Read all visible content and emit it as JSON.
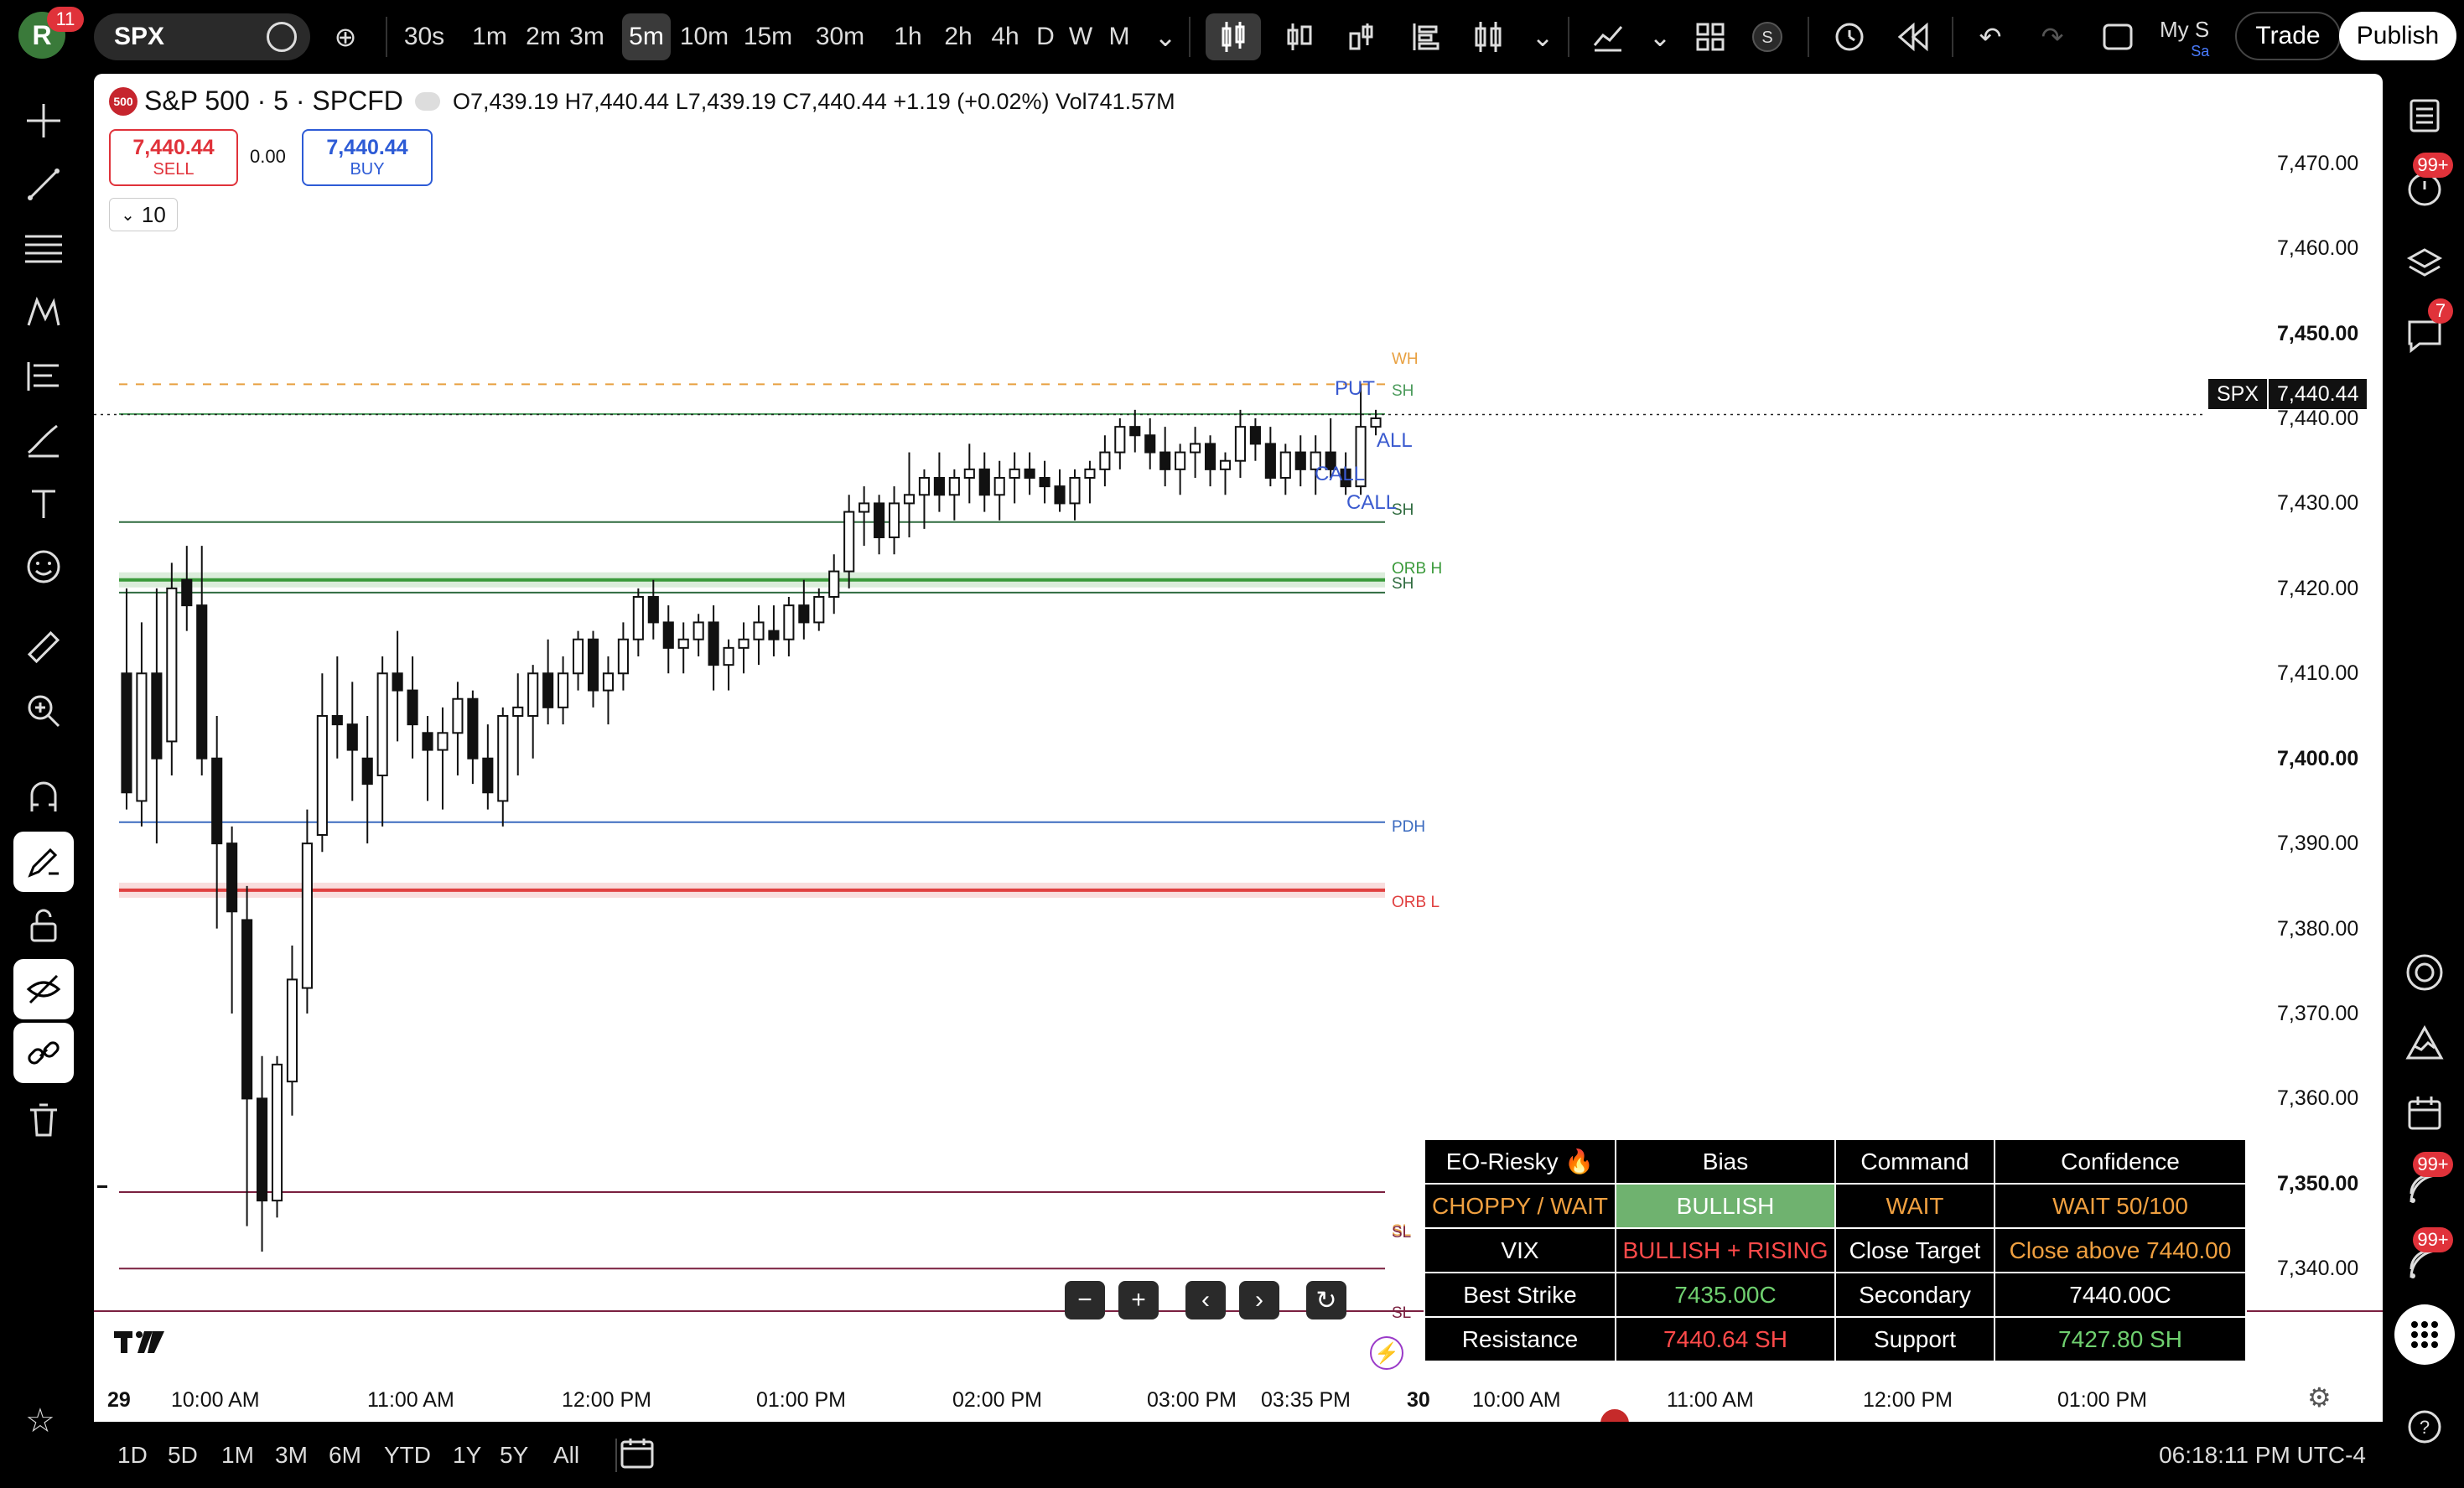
{
  "topbar": {
    "avatar_letter": "R",
    "notification_count": "11",
    "symbol": "SPX",
    "intervals": [
      "30s",
      "1m",
      "2m",
      "3m",
      "5m",
      "10m",
      "15m",
      "30m",
      "1h",
      "2h",
      "4h",
      "D",
      "W",
      "M"
    ],
    "active_interval": "5m",
    "my_s": "My S",
    "my_s_sub": "Sa",
    "trade_label": "Trade",
    "publish_label": "Publish"
  },
  "legend": {
    "logo": "500",
    "title": "S&P 500 · 5 · SPCFD",
    "ohlc": "O7,439.19  H7,440.44  L7,439.19  C7,440.44  +1.19 (+0.02%)  Vol741.57M",
    "sell_price": "7,440.44",
    "sell_label": "SELL",
    "spread": "0.00",
    "buy_price": "7,440.44",
    "buy_label": "BUY",
    "qty": "10"
  },
  "price_tag": {
    "symbol": "SPX",
    "value": "7,440.44"
  },
  "chart_data": {
    "type": "candlestick",
    "y_ticks": [
      "7,470.00",
      "7,460.00",
      "7,450.00",
      "7,440.00",
      "7,430.00",
      "7,420.00",
      "7,410.00",
      "7,400.00",
      "7,390.00",
      "7,380.00",
      "7,370.00",
      "7,360.00",
      "7,350.00",
      "7,340.00"
    ],
    "ylim": [
      7335,
      7475
    ],
    "x_ticks": [
      "29",
      "10:00 AM",
      "11:00 AM",
      "12:00 PM",
      "01:00 PM",
      "02:00 PM",
      "03:00 PM",
      "03:35 PM",
      "30",
      "10:00 AM",
      "11:00 AM",
      "12:00 PM",
      "01:00 PM"
    ],
    "levels": [
      {
        "label": "WH",
        "price": 7444.0,
        "color": "#e8a040",
        "style": "dashed"
      },
      {
        "label": "SH",
        "price": 7440.5,
        "color": "#4a9a5a",
        "style": "solid"
      },
      {
        "label": "SH",
        "price": 7427.8,
        "color": "#2f6b3f",
        "style": "solid"
      },
      {
        "label": "ORB H",
        "price": 7421.0,
        "color": "#3a9a3a",
        "style": "band"
      },
      {
        "label": "SH",
        "price": 7419.5,
        "color": "#2f6b3f",
        "style": "solid"
      },
      {
        "label": "PDH",
        "price": 7392.5,
        "color": "#3a6abf",
        "style": "solid"
      },
      {
        "label": "ORB L",
        "price": 7384.5,
        "color": "#e04040",
        "style": "band"
      },
      {
        "label": "SL",
        "price": 7349.0,
        "color": "#e8a040",
        "style": "dashed"
      },
      {
        "label": "SL",
        "price": 7349.0,
        "color": "#7a2040",
        "style": "solid"
      },
      {
        "label": "SL",
        "price": 7340.0,
        "color": "#7a2040",
        "style": "solid"
      }
    ],
    "annotations": [
      "PUT",
      "CALL",
      "ALL",
      "CALL"
    ],
    "candles": [
      [
        7410,
        7420,
        7394,
        7396
      ],
      [
        7395,
        7416,
        7392,
        7410
      ],
      [
        7410,
        7420,
        7390,
        7400
      ],
      [
        7402,
        7423,
        7398,
        7420
      ],
      [
        7421,
        7425,
        7415,
        7418
      ],
      [
        7418,
        7425,
        7398,
        7400
      ],
      [
        7400,
        7405,
        7380,
        7390
      ],
      [
        7390,
        7392,
        7370,
        7382
      ],
      [
        7381,
        7385,
        7345,
        7360
      ],
      [
        7360,
        7365,
        7342,
        7348
      ],
      [
        7348,
        7365,
        7346,
        7364
      ],
      [
        7362,
        7378,
        7358,
        7374
      ],
      [
        7373,
        7394,
        7370,
        7390
      ],
      [
        7391,
        7410,
        7389,
        7405
      ],
      [
        7405,
        7412,
        7400,
        7404
      ],
      [
        7404,
        7409,
        7395,
        7401
      ],
      [
        7400,
        7405,
        7390,
        7397
      ],
      [
        7398,
        7412,
        7392,
        7410
      ],
      [
        7410,
        7415,
        7402,
        7408
      ],
      [
        7408,
        7412,
        7400,
        7404
      ],
      [
        7403,
        7405,
        7395,
        7401
      ],
      [
        7401,
        7406,
        7394,
        7403
      ],
      [
        7403,
        7409,
        7398,
        7407
      ],
      [
        7407,
        7408,
        7397,
        7400
      ],
      [
        7400,
        7404,
        7394,
        7396
      ],
      [
        7395,
        7406,
        7392,
        7405
      ],
      [
        7405,
        7410,
        7398,
        7406
      ],
      [
        7405,
        7411,
        7400,
        7410
      ],
      [
        7410,
        7414,
        7404,
        7406
      ],
      [
        7406,
        7412,
        7404,
        7410
      ],
      [
        7410,
        7415,
        7408,
        7414
      ],
      [
        7414,
        7415,
        7406,
        7408
      ],
      [
        7408,
        7412,
        7404,
        7410
      ],
      [
        7410,
        7416,
        7408,
        7414
      ],
      [
        7414,
        7420,
        7412,
        7419
      ],
      [
        7419,
        7421,
        7414,
        7416
      ],
      [
        7416,
        7418,
        7410,
        7413
      ],
      [
        7413,
        7416,
        7410,
        7414
      ],
      [
        7414,
        7417,
        7412,
        7416
      ],
      [
        7416,
        7418,
        7408,
        7411
      ],
      [
        7411,
        7414,
        7408,
        7413
      ],
      [
        7413,
        7416,
        7410,
        7414
      ],
      [
        7414,
        7418,
        7411,
        7416
      ],
      [
        7415,
        7418,
        7412,
        7414
      ],
      [
        7414,
        7419,
        7412,
        7418
      ],
      [
        7418,
        7421,
        7414,
        7416
      ],
      [
        7416,
        7420,
        7415,
        7419
      ],
      [
        7419,
        7424,
        7417,
        7422
      ],
      [
        7422,
        7431,
        7420,
        7429
      ],
      [
        7429,
        7432,
        7425,
        7430
      ],
      [
        7430,
        7431,
        7424,
        7426
      ],
      [
        7426,
        7432,
        7424,
        7430
      ],
      [
        7430,
        7436,
        7426,
        7431
      ],
      [
        7431,
        7434,
        7427,
        7433
      ],
      [
        7433,
        7436,
        7429,
        7431
      ],
      [
        7431,
        7434,
        7428,
        7433
      ],
      [
        7433,
        7437,
        7430,
        7434
      ],
      [
        7434,
        7436,
        7429,
        7431
      ],
      [
        7431,
        7435,
        7428,
        7433
      ],
      [
        7433,
        7436,
        7430,
        7434
      ],
      [
        7434,
        7436,
        7431,
        7433
      ],
      [
        7433,
        7435,
        7430,
        7432
      ],
      [
        7432,
        7434,
        7429,
        7430
      ],
      [
        7430,
        7434,
        7428,
        7433
      ],
      [
        7433,
        7435,
        7430,
        7434
      ],
      [
        7434,
        7438,
        7432,
        7436
      ],
      [
        7436,
        7440,
        7434,
        7439
      ],
      [
        7439,
        7441,
        7436,
        7438
      ],
      [
        7438,
        7440,
        7434,
        7436
      ],
      [
        7436,
        7439,
        7432,
        7434
      ],
      [
        7434,
        7437,
        7431,
        7436
      ],
      [
        7436,
        7439,
        7433,
        7437
      ],
      [
        7437,
        7438,
        7432,
        7434
      ],
      [
        7434,
        7436,
        7431,
        7435
      ],
      [
        7435,
        7441,
        7433,
        7439
      ],
      [
        7439,
        7440,
        7435,
        7437
      ],
      [
        7437,
        7439,
        7432,
        7433
      ],
      [
        7433,
        7437,
        7431,
        7436
      ],
      [
        7436,
        7438,
        7432,
        7434
      ],
      [
        7434,
        7438,
        7431,
        7436
      ],
      [
        7436,
        7440,
        7433,
        7434
      ],
      [
        7434,
        7436,
        7431,
        7432
      ],
      [
        7432,
        7444,
        7431,
        7439
      ],
      [
        7439,
        7441,
        7438,
        7440
      ]
    ]
  },
  "level_labels": {
    "wh": "WH",
    "sh1": "SH",
    "sh2": "SH",
    "orbh": "ORB H",
    "sh3": "SH",
    "pdh": "PDH",
    "orbl": "ORB L",
    "sl1": "SL",
    "sl2": "SL",
    "sl3": "SL",
    "put": "PUT",
    "call1": "CALL",
    "all": "ALL",
    "call2": "CALL",
    "sh_top": "SH"
  },
  "dashboard": {
    "rows": [
      [
        {
          "t": "EO-Riesky 🔥",
          "c": "#ffffff"
        },
        {
          "t": "Bias",
          "c": "#ffffff"
        },
        {
          "t": "Command",
          "c": "#ffffff"
        },
        {
          "t": "Confidence",
          "c": "#ffffff"
        }
      ],
      [
        {
          "t": "CHOPPY / WAIT",
          "c": "#f0a040"
        },
        {
          "t": "BULLISH",
          "c": "#ffffff",
          "bg": "#6fb26f"
        },
        {
          "t": "WAIT",
          "c": "#f0a040"
        },
        {
          "t": "WAIT 50/100",
          "c": "#f0a040"
        }
      ],
      [
        {
          "t": "VIX",
          "c": "#ffffff"
        },
        {
          "t": "BULLISH + RISING",
          "c": "#ff4a4a"
        },
        {
          "t": "Close Target",
          "c": "#ffffff"
        },
        {
          "t": "Close above 7440.00",
          "c": "#f0a040"
        }
      ],
      [
        {
          "t": "Best Strike",
          "c": "#ffffff"
        },
        {
          "t": "7435.00C",
          "c": "#6fd06f"
        },
        {
          "t": "Secondary",
          "c": "#ffffff"
        },
        {
          "t": "7440.00C",
          "c": "#ffffff"
        }
      ],
      [
        {
          "t": "Resistance",
          "c": "#ffffff"
        },
        {
          "t": "7440.64  SH",
          "c": "#ff4a4a"
        },
        {
          "t": "Support",
          "c": "#ffffff"
        },
        {
          "t": "7427.80  SH",
          "c": "#6fd06f"
        }
      ]
    ]
  },
  "bottombar": {
    "ranges": [
      "1D",
      "5D",
      "1M",
      "3M",
      "6M",
      "YTD",
      "1Y",
      "5Y",
      "All"
    ],
    "clock": "06:18:11 PM UTC-4"
  },
  "rightbar": {
    "badge1": "99+",
    "badge2": "7",
    "badge3": "99+",
    "badge4": "99+"
  }
}
